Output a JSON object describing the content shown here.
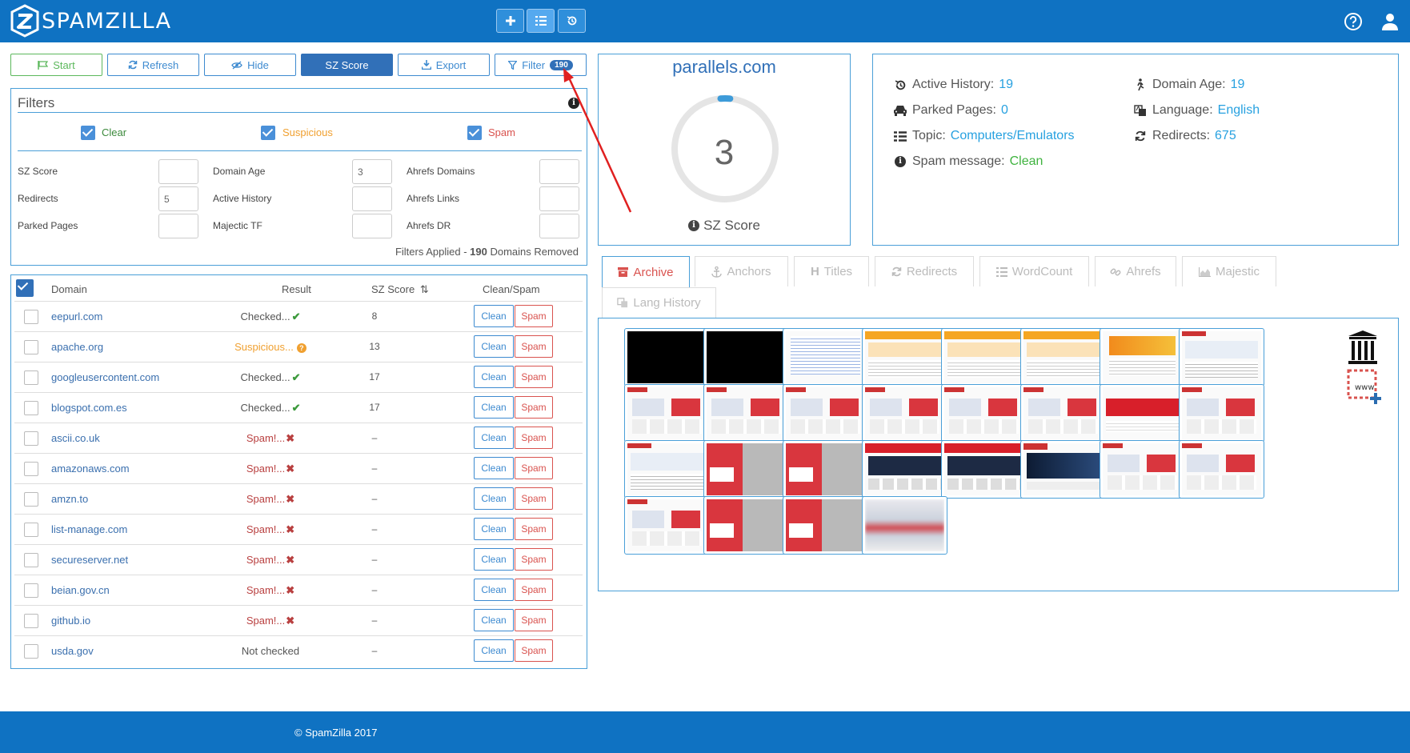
{
  "app": {
    "name": "SPAMZILLA"
  },
  "toolbar": {
    "start": "Start",
    "refresh": "Refresh",
    "hide": "Hide",
    "sz_score": "SZ Score",
    "export": "Export",
    "filter": "Filter",
    "filter_count": "190"
  },
  "filters": {
    "title": "Filters",
    "checks": {
      "clear": "Clear",
      "suspicious": "Suspicious",
      "spam": "Spam"
    },
    "labels": {
      "sz_score": "SZ Score",
      "domain_age": "Domain Age",
      "ahrefs_domains": "Ahrefs Domains",
      "redirects": "Redirects",
      "active_history": "Active History",
      "ahrefs_links": "Ahrefs Links",
      "parked_pages": "Parked Pages",
      "majectic_tf": "Majectic TF",
      "ahrefs_dr": "Ahrefs DR"
    },
    "values": {
      "domain_age": "3",
      "redirects": "5"
    },
    "summary_prefix": "Filters Applied - ",
    "summary_count": "190",
    "summary_suffix": " Domains Removed"
  },
  "table": {
    "headers": {
      "domain": "Domain",
      "result": "Result",
      "sz_score": "SZ Score",
      "clean_spam": "Clean/Spam"
    },
    "clean_label": "Clean",
    "spam_label": "Spam",
    "rows": [
      {
        "domain": "eepurl.com",
        "result": "Checked...",
        "status": "ok",
        "score": "8"
      },
      {
        "domain": "apache.org",
        "result": "Suspicious...",
        "status": "sus",
        "score": "13"
      },
      {
        "domain": "googleusercontent.com",
        "result": "Checked...",
        "status": "ok",
        "score": "17"
      },
      {
        "domain": "blogspot.com.es",
        "result": "Checked...",
        "status": "ok",
        "score": "17"
      },
      {
        "domain": "ascii.co.uk",
        "result": "Spam!...",
        "status": "spam",
        "score": "–"
      },
      {
        "domain": "amazonaws.com",
        "result": "Spam!...",
        "status": "spam",
        "score": "–"
      },
      {
        "domain": "amzn.to",
        "result": "Spam!...",
        "status": "spam",
        "score": "–"
      },
      {
        "domain": "list-manage.com",
        "result": "Spam!...",
        "status": "spam",
        "score": "–"
      },
      {
        "domain": "secureserver.net",
        "result": "Spam!...",
        "status": "spam",
        "score": "–"
      },
      {
        "domain": "beian.gov.cn",
        "result": "Spam!...",
        "status": "spam",
        "score": "–"
      },
      {
        "domain": "github.io",
        "result": "Spam!...",
        "status": "spam",
        "score": "–"
      },
      {
        "domain": "usda.gov",
        "result": "Not checked",
        "status": "nc",
        "score": "–"
      }
    ]
  },
  "score_card": {
    "domain": "parallels.com",
    "score": "3",
    "score_fraction": 0.03,
    "label": "SZ Score"
  },
  "info": {
    "active_history_label": "Active History:",
    "active_history": "19",
    "parked_pages_label": "Parked Pages:",
    "parked_pages": "0",
    "topic_label": "Topic:",
    "topic": "Computers/Emulators",
    "spam_message_label": "Spam message:",
    "spam_message": "Clean",
    "domain_age_label": "Domain Age:",
    "domain_age": "19",
    "language_label": "Language:",
    "language": "English",
    "redirects_label": "Redirects:",
    "redirects": "675"
  },
  "tabs": [
    "Archive",
    "Anchors",
    "Titles",
    "Redirects",
    "WordCount",
    "Ahrefs",
    "Majestic",
    "Lang History"
  ],
  "active_tab": "Archive",
  "thumbnails": [
    {
      "theme": "black"
    },
    {
      "theme": "black"
    },
    {
      "theme": "text"
    },
    {
      "theme": "orange"
    },
    {
      "theme": "orange"
    },
    {
      "theme": "orange"
    },
    {
      "theme": "orange-banner"
    },
    {
      "theme": "light"
    },
    {
      "theme": "red-white"
    },
    {
      "theme": "red-white"
    },
    {
      "theme": "red-white"
    },
    {
      "theme": "red-white"
    },
    {
      "theme": "red-white"
    },
    {
      "theme": "red-white"
    },
    {
      "theme": "red-banner"
    },
    {
      "theme": "red-white"
    },
    {
      "theme": "light"
    },
    {
      "theme": "red-grey"
    },
    {
      "theme": "red-grey"
    },
    {
      "theme": "red-dark"
    },
    {
      "theme": "red-dark"
    },
    {
      "theme": "dark-blue"
    },
    {
      "theme": "red-white"
    },
    {
      "theme": "red-white"
    },
    {
      "theme": "red-white"
    },
    {
      "theme": "red-grey"
    },
    {
      "theme": "red-grey"
    },
    {
      "theme": "blurred"
    }
  ],
  "footer": {
    "copyright": "© SpamZilla 2017"
  }
}
